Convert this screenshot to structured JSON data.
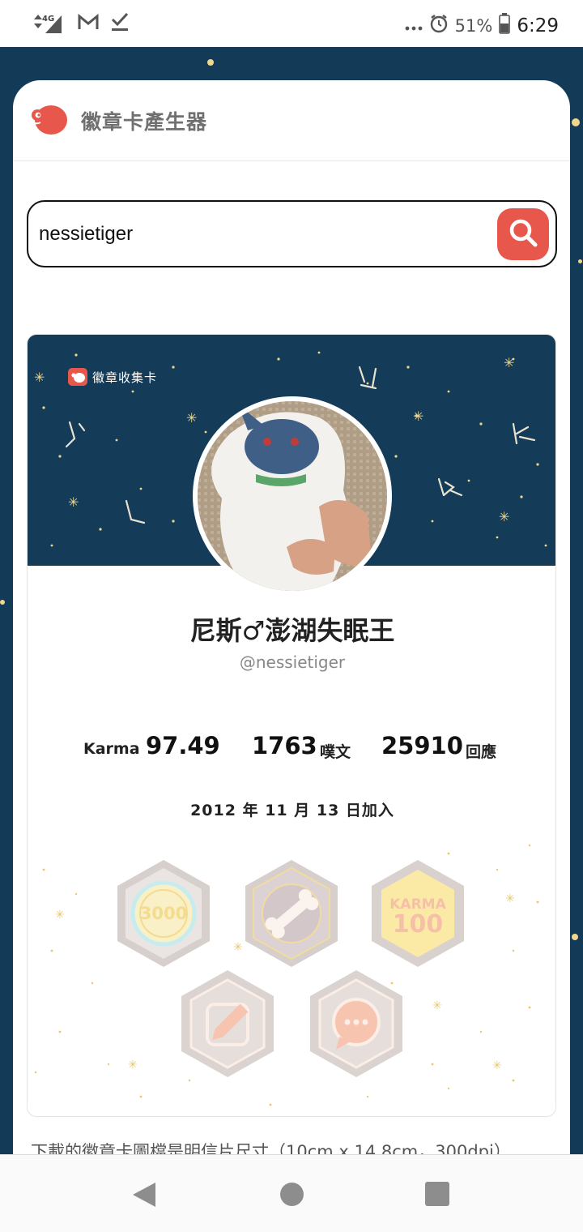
{
  "status_bar": {
    "network": "4G",
    "battery": "51%",
    "time": "6:29",
    "icons": [
      "signal-icon",
      "gmail-icon",
      "check-icon",
      "more-icon",
      "alarm-icon",
      "battery-icon"
    ]
  },
  "app": {
    "title": "徽章卡產生器",
    "logo_icon": "plurk-logo-icon"
  },
  "search": {
    "value": "nessietiger",
    "button_icon": "search-icon"
  },
  "badge_card": {
    "brand": "徽章收集卡",
    "nickname": "尼斯♂澎湖失眠王",
    "handle": "@nessietiger",
    "stats": {
      "karma_label": "Karma",
      "karma_value": "97.49",
      "posts_value": "1763",
      "posts_label": "噗文",
      "responses_value": "25910",
      "responses_label": "回應"
    },
    "joined": "2012 年 11 月 13 日加入",
    "badges": [
      {
        "name": "3000-badge",
        "text": "3000"
      },
      {
        "name": "bone-badge",
        "text": ""
      },
      {
        "name": "karma-100-badge",
        "text": "KARMA",
        "text2": "100"
      },
      {
        "name": "pencil-badge",
        "text": ""
      },
      {
        "name": "chat-badge",
        "text": ""
      }
    ]
  },
  "note": "下載的徽章卡圖檔是明信片尺寸（10cm x 14.8cm，300dpi）",
  "colors": {
    "accent": "#e8574b",
    "night": "#143b58",
    "star": "#f2d78a"
  }
}
